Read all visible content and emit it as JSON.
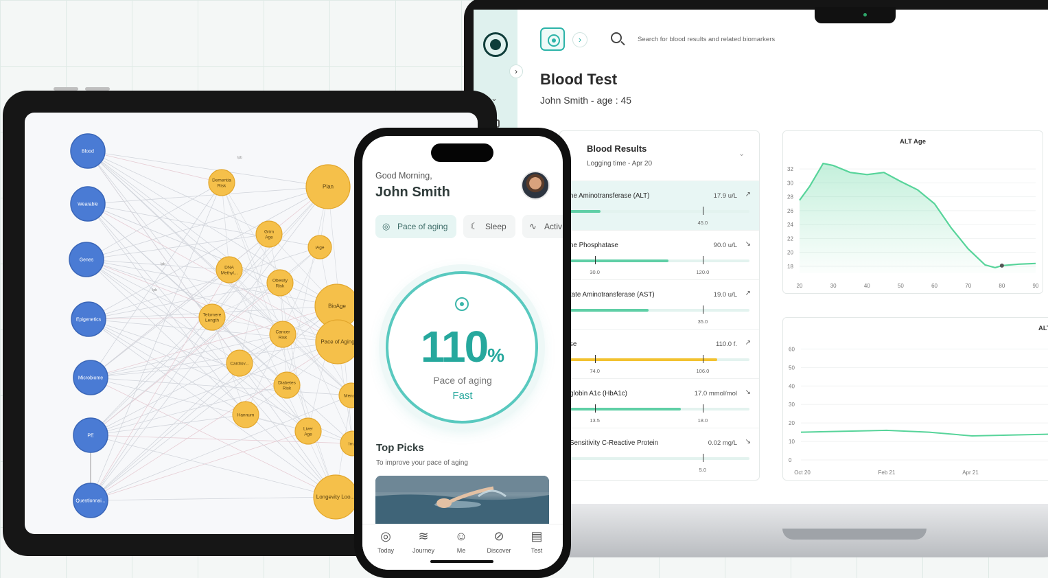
{
  "laptop": {
    "search": {
      "placeholder": "Search for blood results and related biomarkers"
    },
    "page_title": "Blood Test",
    "patient": "John Smith - age : 45",
    "results": {
      "title": "Blood Results",
      "subtitle": "Logging time - Apr 20",
      "rows": [
        {
          "name": "ne Aminotransferase (ALT)",
          "value": "17.9 u/L",
          "trend": "↗",
          "fill": 0.17,
          "color": "#5fcfa6",
          "ticks": [
            "45.0"
          ],
          "tickpos": [
            0.74
          ]
        },
        {
          "name": "ne Phosphatase",
          "value": "90.0 u/L",
          "trend": "↘",
          "fill": 0.55,
          "color": "#5fcfa6",
          "ticks": [
            "30.0",
            "120.0"
          ],
          "tickpos": [
            0.14,
            0.74
          ]
        },
        {
          "name": "tate Aminotransferase (AST)",
          "value": "19.0 u/L",
          "trend": "↗",
          "fill": 0.44,
          "color": "#5fcfa6",
          "ticks": [
            "35.0"
          ],
          "tickpos": [
            0.74
          ]
        },
        {
          "name": "se",
          "value": "110.0 f.",
          "trend": "↗",
          "fill": 0.82,
          "color": "#f2c230",
          "ticks": [
            "74.0",
            "106.0"
          ],
          "tickpos": [
            0.14,
            0.74
          ]
        },
        {
          "name": "globin A1c (HbA1c)",
          "value": "17.0 mmol/mol",
          "trend": "↘",
          "fill": 0.62,
          "color": "#5fcfa6",
          "ticks": [
            "13.5",
            "18.0"
          ],
          "tickpos": [
            0.14,
            0.74
          ]
        },
        {
          "name": "Sensitivity C-Reactive Protein",
          "value": "0.02 mg/L",
          "trend": "↘",
          "fill": 0.0,
          "color": "#5fcfa6",
          "ticks": [
            "5.0"
          ],
          "tickpos": [
            0.74
          ]
        }
      ]
    }
  },
  "chart_data": [
    {
      "type": "area",
      "title": "ALT Age",
      "x": [
        20,
        23,
        27,
        30,
        35,
        40,
        45,
        50,
        55,
        60,
        65,
        70,
        75,
        78,
        80,
        85,
        90
      ],
      "y": [
        27.5,
        29.5,
        32.8,
        32.5,
        31.5,
        31.2,
        31.5,
        30.2,
        29,
        27,
        23.5,
        20.5,
        18.2,
        17.8,
        18.1,
        18.3,
        18.4
      ],
      "xticks": [
        "20",
        "30",
        "40",
        "50",
        "60",
        "70",
        "80",
        "90"
      ],
      "yticks": [
        "18",
        "20",
        "22",
        "24",
        "26",
        "28",
        "30",
        "32"
      ],
      "xlim": [
        20,
        90
      ],
      "ylim": [
        17,
        33.5
      ],
      "highlight_x": 80,
      "color": "#57d49a"
    },
    {
      "type": "line",
      "title": "ALT",
      "x": [
        0,
        1,
        2,
        3,
        4,
        5,
        6
      ],
      "y": [
        15,
        15.5,
        16,
        15,
        13,
        13.5,
        14
      ],
      "xticks": [
        "Oct 20",
        "Feb 21",
        "Apr 21"
      ],
      "xtickpos": [
        0,
        3,
        6
      ],
      "yticks": [
        "0",
        "10",
        "20",
        "30",
        "40",
        "50",
        "60"
      ],
      "ylim": [
        0,
        62
      ],
      "color": "#57d49a"
    }
  ],
  "tablet": {
    "edge_labels": [
      "Ipb",
      "Ipb",
      "Ipb"
    ],
    "nodes_blue": [
      "Blood",
      "Wearable",
      "Genes",
      "Epigenetics",
      "Microbiome",
      "PE",
      "Questionnai..."
    ],
    "nodes_orange": [
      "Dementia Risk",
      "Plan",
      "Grim Age",
      "iAge",
      "DNA Methyl...",
      "Obesity Risk",
      "BioAge",
      "Telomere Length",
      "Cancer Risk",
      "Pace of Aging",
      "Cardiov...",
      "Diabetes Risk",
      "Meno...",
      "Hannum",
      "Liver Age",
      "Im...",
      "Longevity Loo..."
    ]
  },
  "phone": {
    "greeting": "Good Morning,",
    "name": "John Smith",
    "chips": [
      "Pace of aging",
      "Sleep",
      "Activ"
    ],
    "pace_value": "110",
    "pace_unit": "%",
    "pace_label": "Pace of aging",
    "pace_speed": "Fast",
    "top_picks": "Top Picks",
    "top_picks_sub": "To improve your pace of aging",
    "nav": [
      "Today",
      "Journey",
      "Me",
      "Discover",
      "Test"
    ]
  }
}
